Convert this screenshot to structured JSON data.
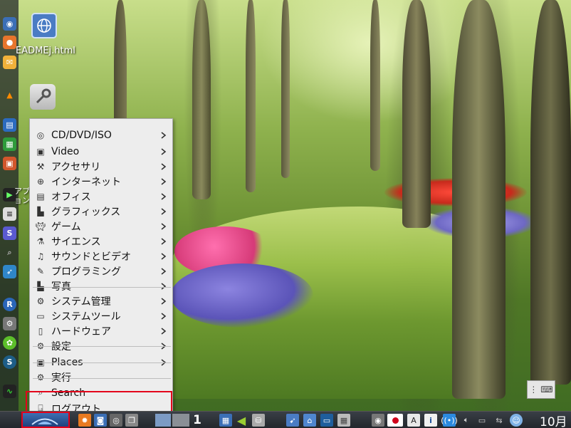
{
  "desktop": {
    "icons": [
      {
        "name": "html-file",
        "label": "EADMEj.html"
      },
      {
        "name": "settings-tool",
        "label": ""
      }
    ],
    "partial_label": "アプ\nョン"
  },
  "start_menu": {
    "items": [
      {
        "key": "cd",
        "label": "CD/DVD/ISO",
        "icon": "disc-icon",
        "submenu": true
      },
      {
        "key": "video",
        "label": "Video",
        "icon": "film-icon",
        "submenu": true
      },
      {
        "key": "acc",
        "label": "アクセサリ",
        "icon": "tools-icon",
        "submenu": true
      },
      {
        "key": "net",
        "label": "インターネット",
        "icon": "globe-icon",
        "submenu": true
      },
      {
        "key": "office",
        "label": "オフィス",
        "icon": "document-icon",
        "submenu": true
      },
      {
        "key": "graphics",
        "label": "グラフィックス",
        "icon": "chart-icon",
        "submenu": true
      },
      {
        "key": "game",
        "label": "ゲーム",
        "icon": "alien-icon",
        "submenu": true
      },
      {
        "key": "science",
        "label": "サイエンス",
        "icon": "flask-icon",
        "submenu": true
      },
      {
        "key": "sound",
        "label": "サウンドとビデオ",
        "icon": "sound-video-icon",
        "submenu": true
      },
      {
        "key": "prog",
        "label": "プログラミング",
        "icon": "code-icon",
        "submenu": true
      },
      {
        "key": "photo",
        "label": "写真",
        "icon": "photo-icon",
        "submenu": true
      },
      {
        "key": "sysadmin",
        "label": "システム管理",
        "icon": "gear-icon",
        "submenu": true
      },
      {
        "key": "systools",
        "label": "システムツール",
        "icon": "monitor-icon",
        "submenu": true
      },
      {
        "key": "hardware",
        "label": "ハードウェア",
        "icon": "phone-icon",
        "submenu": true
      },
      {
        "key": "settings",
        "label": "設定",
        "icon": "cog-icon",
        "submenu": true
      },
      {
        "key": "places",
        "label": "Places",
        "icon": "folder-icon",
        "submenu": true
      },
      {
        "key": "run",
        "label": "実行",
        "icon": "run-icon",
        "submenu": false
      },
      {
        "key": "search",
        "label": "Search",
        "icon": "search-icon",
        "submenu": false
      },
      {
        "key": "logout",
        "label": "ログアウト",
        "icon": "logout-icon",
        "submenu": false
      }
    ]
  },
  "taskbar": {
    "workspace_number": "1",
    "clock_text": "10月",
    "input_method_letter": "A",
    "info_letter": "i"
  },
  "colors": {
    "highlight": "#e3001b",
    "menu_bg": "#ededed",
    "taskbar_bg": "#2b3036"
  }
}
